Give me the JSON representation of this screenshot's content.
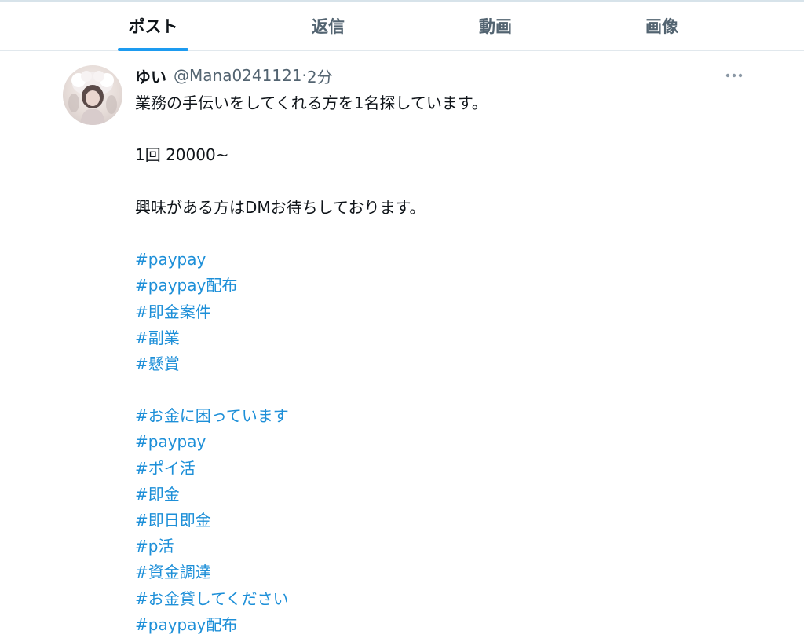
{
  "tabs": [
    {
      "label": "ポスト"
    },
    {
      "label": "返信"
    },
    {
      "label": "動画"
    },
    {
      "label": "画像"
    }
  ],
  "active_tab": "ポスト",
  "colors": {
    "accent": "#1d9bf0",
    "hashtag": "#1d8fd8",
    "secondary_text": "#536471"
  },
  "post": {
    "display_name": "ゆい",
    "handle": "@Mana0241121",
    "separator": "·",
    "time": "2分",
    "more_icon": "ellipsis-icon",
    "lines": [
      "業務の手伝いをしてくれる方を1名探しています。",
      "1回 20000~",
      "興味がある方はDMお待ちしております。"
    ],
    "hashtags_group1": [
      "#paypay",
      "#paypay配布",
      "#即金案件",
      "#副業",
      "#懸賞"
    ],
    "hashtags_group2": [
      "#お金に困っています",
      "#paypay",
      "#ポイ活",
      "#即金",
      "#即日即金",
      "#p活",
      "#資金調達",
      "#お金貸してください",
      "#paypay配布"
    ]
  }
}
